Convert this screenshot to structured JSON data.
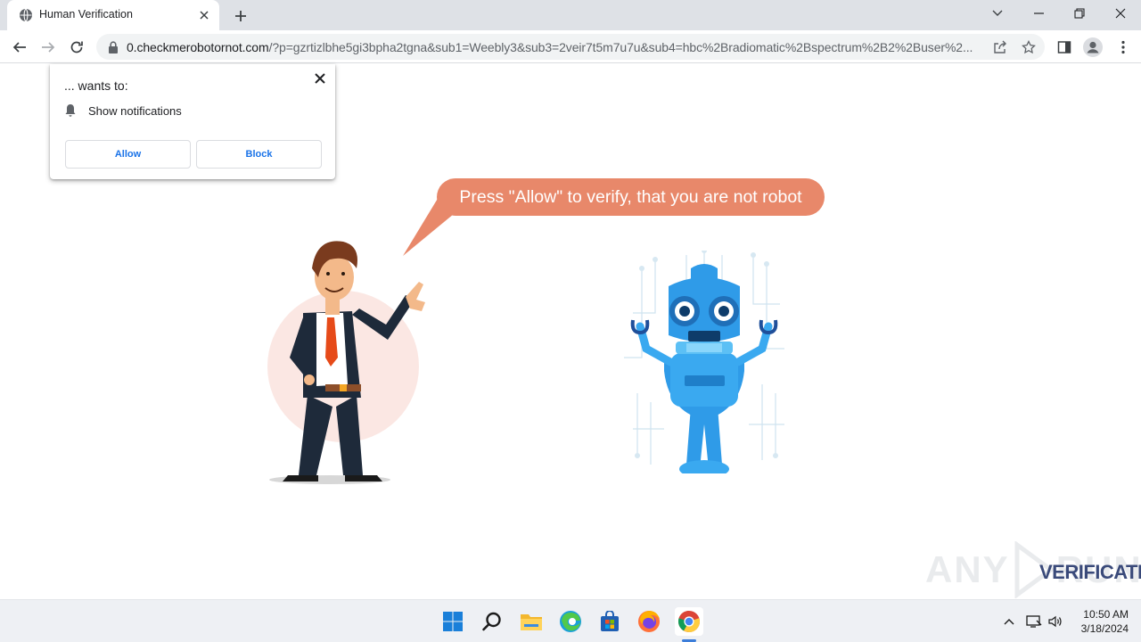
{
  "browser": {
    "tab_title": "Human Verification",
    "url_host": "0.checkmerobotornot.com",
    "url_rest": "/?p=gzrtizlbhe5gi3bpha2tgna&sub1=Weebly3&sub3=2veir7t5m7u7u&sub4=hbc%2Bradiomatic%2Bspectrum%2B2%2Buser%2..."
  },
  "popup": {
    "origin_text": "... wants to:",
    "permission_text": "Show notifications",
    "allow_label": "Allow",
    "block_label": "Block"
  },
  "page": {
    "bubble_text": "Press \"Allow\" to verify, that you are not robot"
  },
  "watermark": {
    "left": "ANY",
    "right": "RUN",
    "sub": "VERIFICATION"
  },
  "taskbar": {
    "icons": [
      "windows-start-icon",
      "search-icon",
      "file-explorer-icon",
      "edge-icon",
      "store-icon",
      "firefox-icon",
      "chrome-icon"
    ],
    "time": "10:50 AM",
    "date": "3/18/2024"
  },
  "colors": {
    "bubble": "#e8886a",
    "accent": "#1a73e8"
  }
}
